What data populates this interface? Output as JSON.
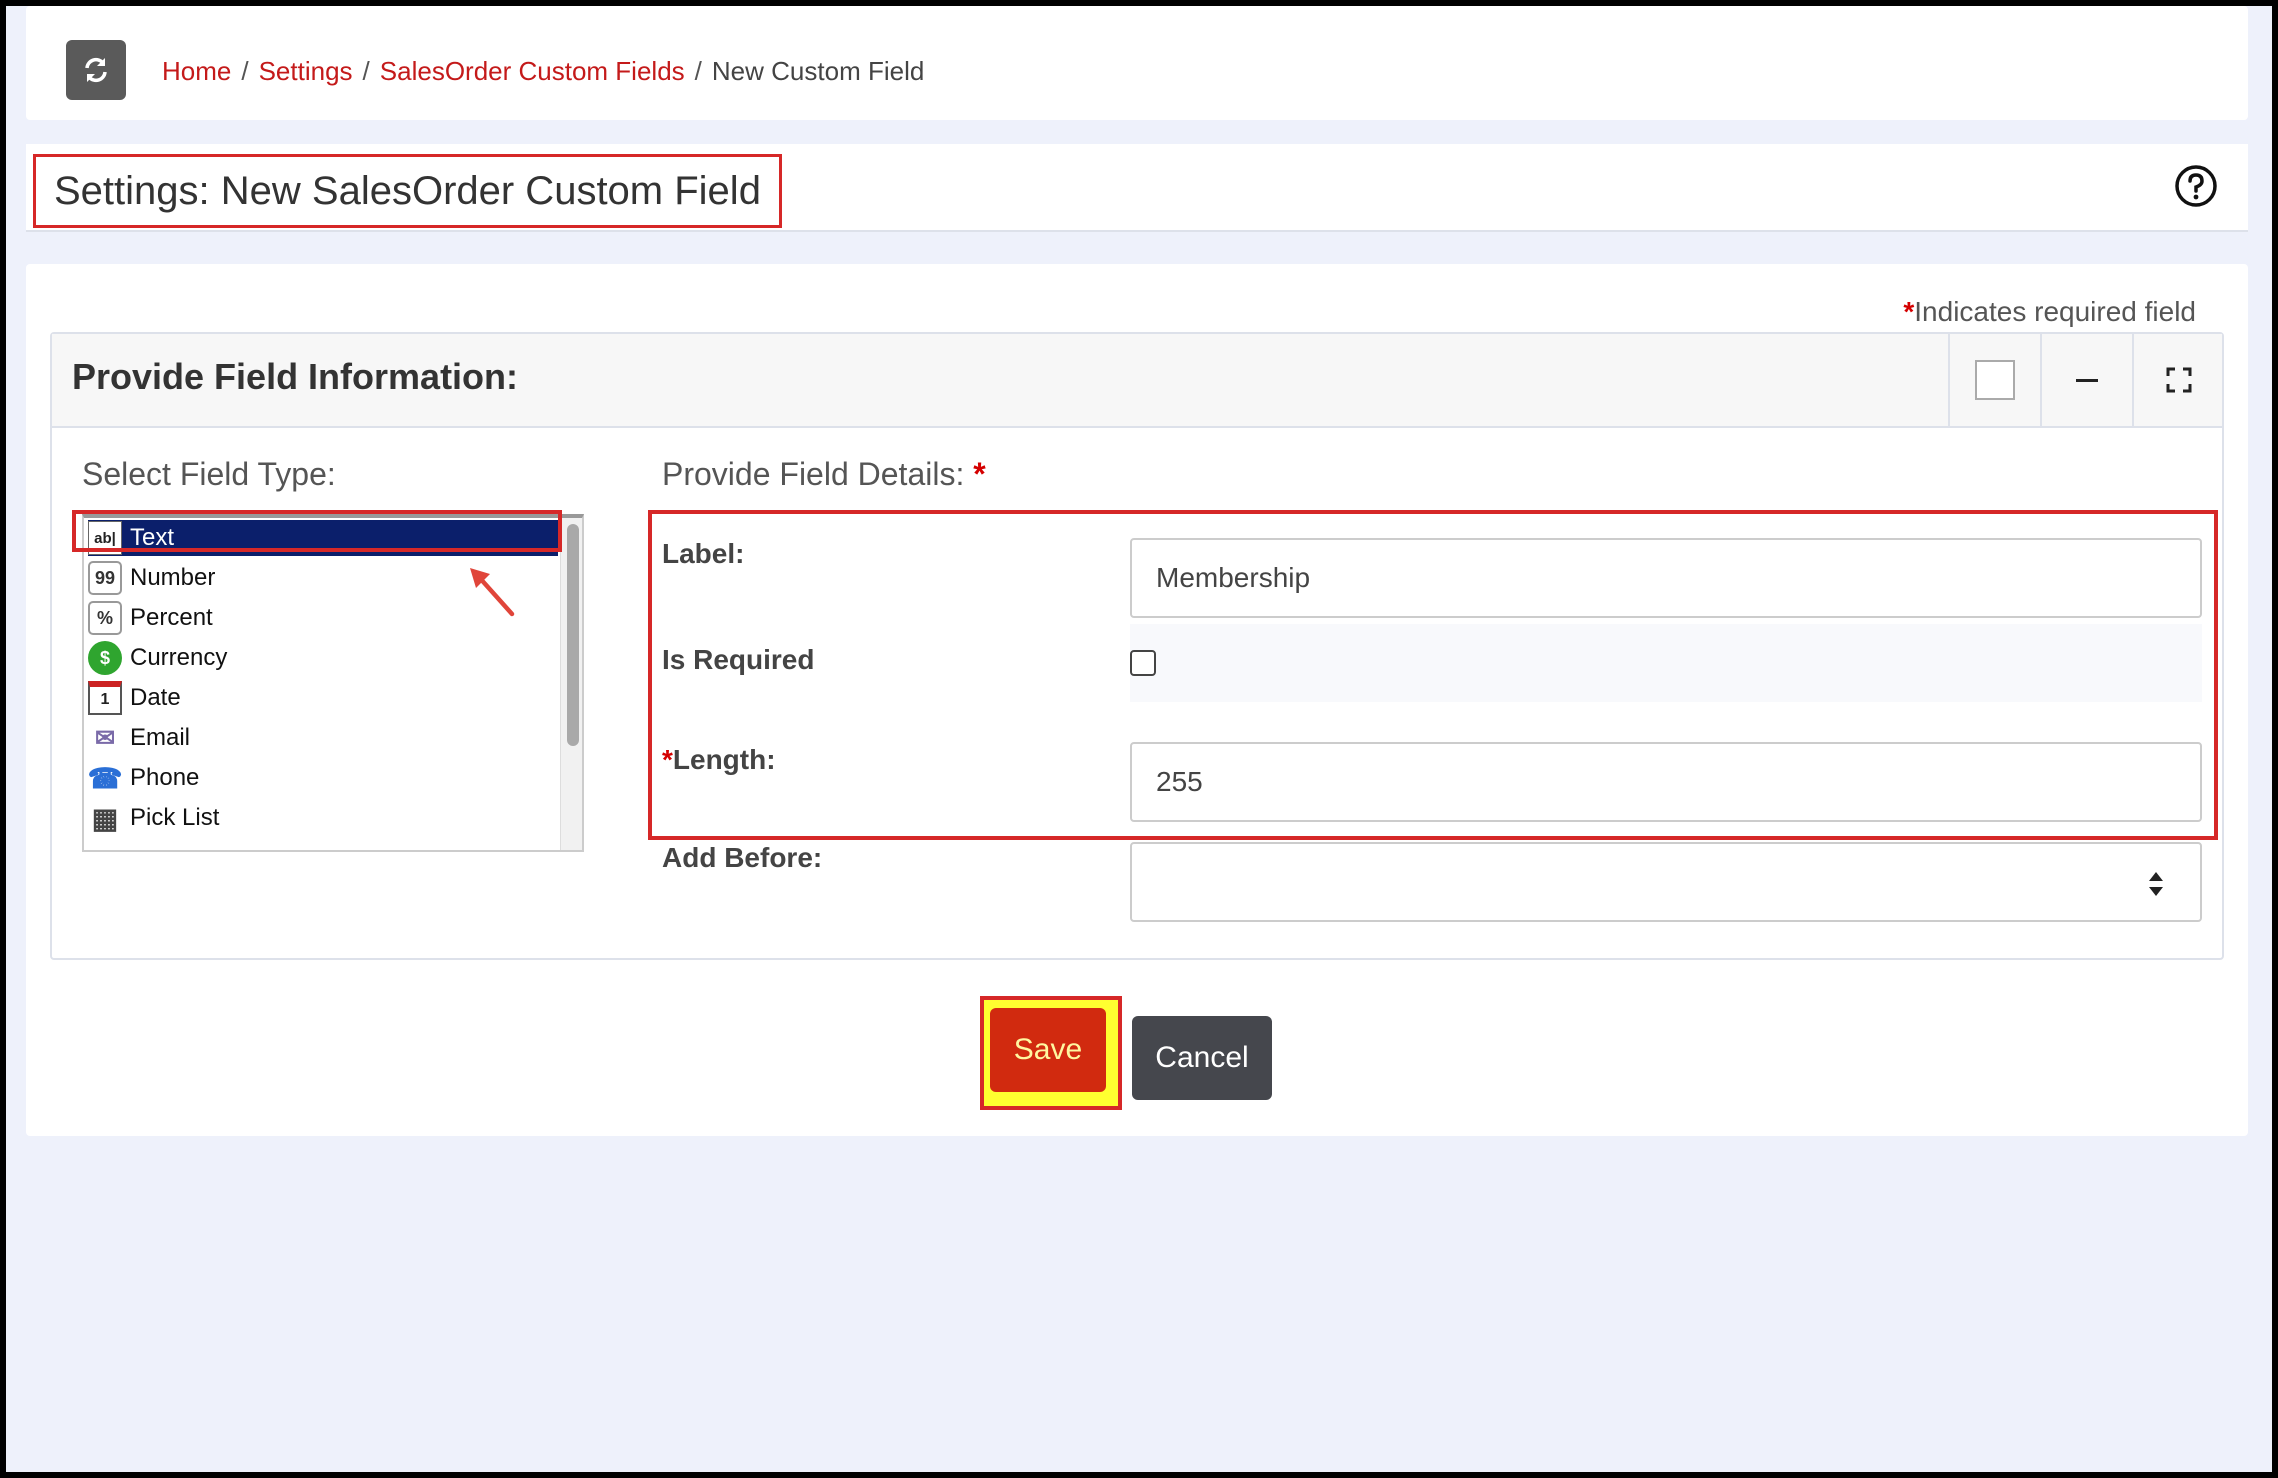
{
  "breadcrumb": {
    "items": [
      "Home",
      "Settings",
      "SalesOrder Custom Fields"
    ],
    "separator": "/",
    "current": "New Custom Field"
  },
  "page": {
    "title": "Settings: New SalesOrder Custom Field"
  },
  "form": {
    "required_star": "*",
    "required_note": "Indicates required field",
    "panel_title": "Provide Field Information:",
    "select_type_label": "Select Field Type:",
    "details_label": "Provide Field Details:",
    "field_types": [
      {
        "label": "Text",
        "icon": "ab|",
        "icon_name": "text-field-icon",
        "selected": true
      },
      {
        "label": "Number",
        "icon": "99",
        "icon_name": "number-icon"
      },
      {
        "label": "Percent",
        "icon": "%",
        "icon_name": "percent-icon"
      },
      {
        "label": "Currency",
        "icon": "$",
        "icon_name": "currency-icon"
      },
      {
        "label": "Date",
        "icon": "1",
        "icon_name": "calendar-icon"
      },
      {
        "label": "Email",
        "icon": "✉",
        "icon_name": "email-icon"
      },
      {
        "label": "Phone",
        "icon": "☎",
        "icon_name": "phone-icon"
      },
      {
        "label": "Pick List",
        "icon": "▦",
        "icon_name": "picklist-icon"
      }
    ],
    "label_field": {
      "label": "Label:",
      "value": "Membership"
    },
    "is_required": {
      "label": "Is Required",
      "checked": false
    },
    "length_field": {
      "label": "Length:",
      "value": "255"
    },
    "add_before": {
      "label": "Add Before:",
      "value": ""
    },
    "save_label": "Save",
    "cancel_label": "Cancel"
  },
  "colors": {
    "link": "#c41a1a",
    "selected_row": "#0b1f6b",
    "save_button": "#d12a0f",
    "annotation": "#d62828",
    "highlight": "#ffff30"
  }
}
